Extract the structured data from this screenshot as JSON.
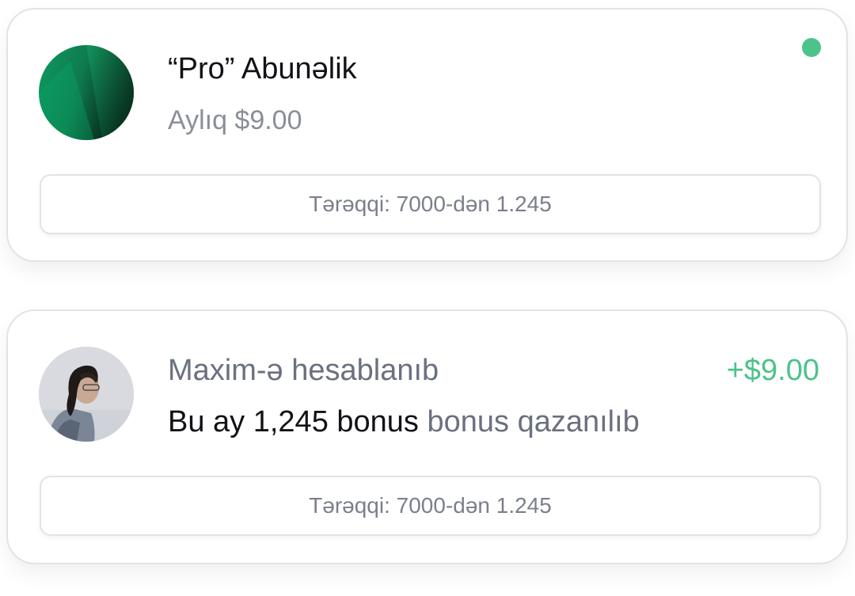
{
  "subscription_card": {
    "title": "“Pro” Abunəlik",
    "price": "Aylıq $9.00",
    "status_color": "#4cc38a",
    "avatar_icon": "green-gradient-avatar",
    "progress_text": "Tərəqqi: 7000-dən 1.245"
  },
  "charge_card": {
    "title": "Maxim-ə hesablanıb",
    "amount": "+$9.00",
    "amount_color": "#4cc38a",
    "avatar_icon": "user-photo-avatar",
    "description_main": "Bu ay 1,245 bonus",
    "description_muted": "bonus qazanılıb",
    "progress_text": "Tərəqqi: 7000-dən 1.245"
  }
}
